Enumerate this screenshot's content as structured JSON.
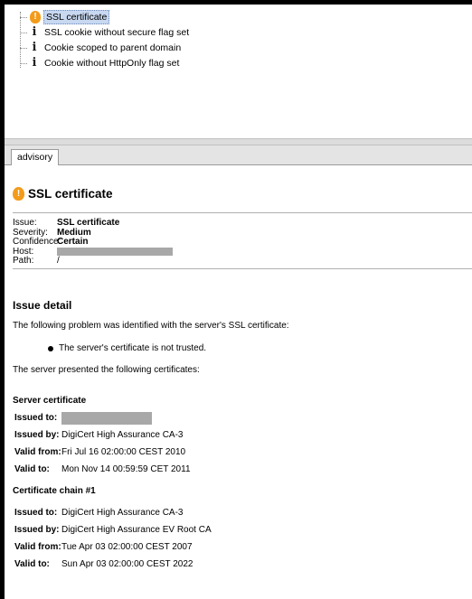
{
  "tree": {
    "items": [
      {
        "label": "SSL certificate",
        "icon": "warning-icon",
        "selected": true
      },
      {
        "label": "SSL cookie without secure flag set",
        "icon": "info-icon"
      },
      {
        "label": "Cookie scoped to parent domain",
        "icon": "info-icon"
      },
      {
        "label": "Cookie without HttpOnly flag set",
        "icon": "info-icon"
      }
    ]
  },
  "tabs": [
    {
      "label": "advisory"
    }
  ],
  "advisory": {
    "title": "SSL certificate",
    "summary": {
      "issue_label": "Issue:",
      "issue_value": "SSL certificate",
      "severity_label": "Severity:",
      "severity_value": "Medium",
      "confidence_label": "Confidence:",
      "confidence_value": "Certain",
      "host_label": "Host:",
      "path_label": "Path:",
      "path_value": "/"
    },
    "detail_heading": "Issue detail",
    "detail_intro": "The following problem was identified with the server's SSL certificate:",
    "detail_bullet": "The server's certificate is not trusted.",
    "presented_text": "The server presented the following certificates:",
    "server_cert": {
      "heading": "Server certificate",
      "issued_to_label": "Issued to:",
      "issued_by_label": "Issued by:",
      "issued_by_value": "DigiCert High Assurance CA-3",
      "valid_from_label": "Valid from:",
      "valid_from_value": "Fri Jul 16 02:00:00 CEST 2010",
      "valid_to_label": "Valid to:",
      "valid_to_value": "Mon Nov 14 00:59:59 CET 2011"
    },
    "chain_cert": {
      "heading": "Certificate chain #1",
      "issued_to_label": "Issued to:",
      "issued_to_value": "DigiCert High Assurance CA-3",
      "issued_by_label": "Issued by:",
      "issued_by_value": "DigiCert High Assurance EV Root CA",
      "valid_from_label": "Valid from:",
      "valid_from_value": "Tue Apr 03 02:00:00 CEST 2007",
      "valid_to_label": "Valid to:",
      "valid_to_value": "Sun Apr 03 02:00:00 CEST 2022"
    }
  },
  "colors": {
    "warning": "#f39b1a",
    "selection": "#c8d8f0"
  }
}
